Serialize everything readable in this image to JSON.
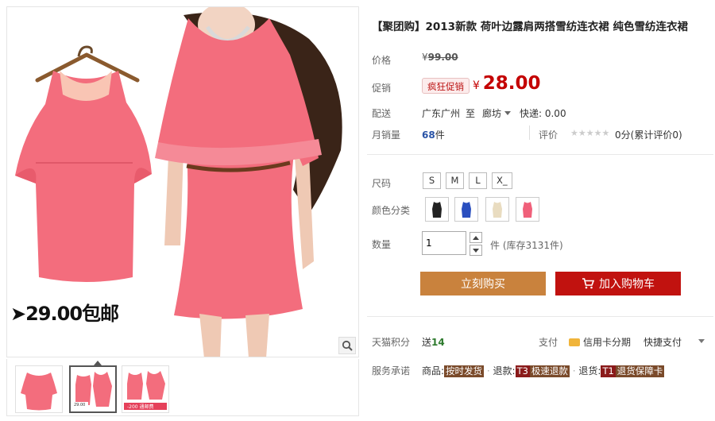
{
  "gallery": {
    "promo_text": "➤29.00包邮",
    "thumbnails": [
      {
        "name": "thumbnail-1",
        "active": false
      },
      {
        "name": "thumbnail-2",
        "active": true
      },
      {
        "name": "thumbnail-3",
        "active": false
      }
    ]
  },
  "product": {
    "title": "【聚团购】2013新款 荷叶边露肩两搭雪纺连衣裙 纯色雪纺连衣裙",
    "price_label": "价格",
    "price_currency": "¥",
    "price_original": "99.00",
    "promo_label": "促销",
    "promo_badge": "疯狂促销",
    "promo_currency": "¥",
    "promo_price": "28.00",
    "delivery_label": "配送",
    "delivery_from": "广东广州",
    "delivery_to_word": "至",
    "delivery_to": "廊坊",
    "delivery_fee": "快递: 0.00",
    "sales_label": "月销量",
    "sales_count": "68",
    "sales_unit": "件",
    "review_label": "评价",
    "review_stars": "★★★★★",
    "review_score": "0分(累计评价0)"
  },
  "options": {
    "size_label": "尺码",
    "sizes": [
      "S",
      "M",
      "L",
      "X_"
    ],
    "color_label": "颜色分类",
    "colors": [
      "#222222",
      "#2a4fbf",
      "#e9dcc0",
      "#f0607a"
    ],
    "qty_label": "数量",
    "qty_value": "1",
    "stock_text": "件 (库存3131件)"
  },
  "actions": {
    "buy_label": "立刻购买",
    "cart_label": "加入购物车"
  },
  "footer": {
    "points_label": "天猫积分",
    "points_prefix": "送",
    "points_value": "14",
    "pay_label": "支付",
    "pay_card": "信用卡分期",
    "pay_fast": "快捷支付",
    "service_label": "服务承诺",
    "svc1_prefix": "商品:",
    "svc1_tag": "按时发货",
    "svc2_prefix": "退款:",
    "svc2_tag_code": "T3",
    "svc2_tag": "极速退款",
    "svc3_prefix": "退货:",
    "svc3_tag_code": "T1",
    "svc3_tag": "退货保障卡"
  },
  "colors": {
    "accent_red": "#c40000",
    "buy_button": "#c9823d",
    "cart_button": "#c1120f"
  }
}
